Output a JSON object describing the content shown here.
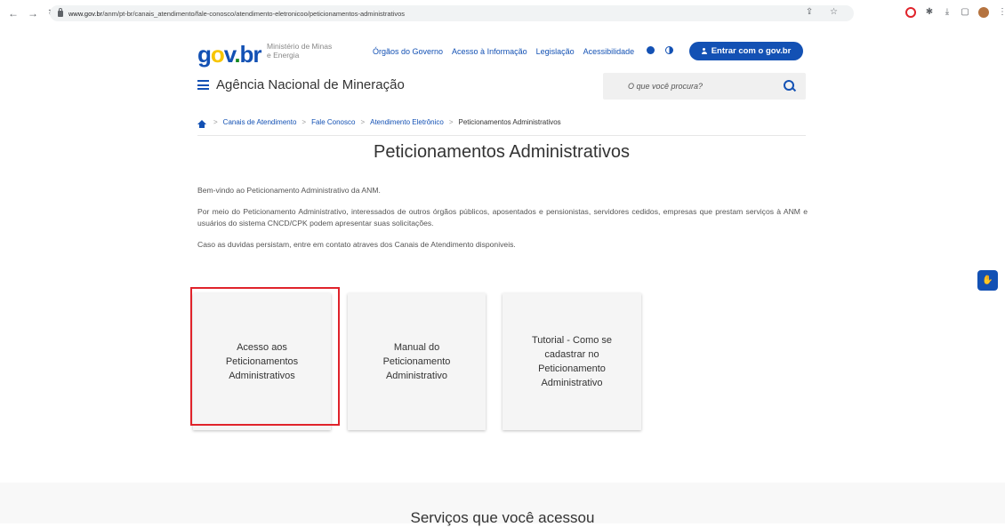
{
  "browser": {
    "url_host": "www.gov.br",
    "url_path": "/anm/pt-br/canais_atendimento/fale-conosco/atendimento-eletronicoo/peticionamentos-administrativos"
  },
  "header": {
    "logo": {
      "g": "g",
      "o": "o",
      "v": "v",
      "dot": ".",
      "br": "br"
    },
    "ministry": "Ministério de Minas e Energia",
    "links": [
      "Órgãos do Governo",
      "Acesso à Informação",
      "Legislação",
      "Acessibilidade"
    ],
    "login_label": "Entrar com o gov.br",
    "agency": "Agência Nacional de Mineração",
    "search_placeholder": "O que você procura?"
  },
  "breadcrumb": {
    "items": [
      "Canais de Atendimento",
      "Fale Conosco",
      "Atendimento Eletrônico"
    ],
    "current": "Peticionamentos Administrativos",
    "separator": ">"
  },
  "main": {
    "title": "Peticionamentos Administrativos",
    "paragraphs": [
      "Bem-vindo ao Peticionamento Administrativo da ANM.",
      "Por meio do Peticionamento Administrativo, interessados de outros órgãos públicos, aposentados e pensionistas, servidores cedidos, empresas que prestam serviços à ANM e usuários do sistema CNCD/CPK podem apresentar suas solicitações.",
      "Caso as duvidas persistam, entre em contato atraves dos Canais de Atendimento disponiveis."
    ],
    "cards": [
      "Acesso aos Peticionamentos Administrativos",
      "Manual do Peticionamento Administrativo",
      "Tutorial - Como se cadastrar no Peticionamento Administrativo"
    ]
  },
  "services": {
    "title": "Serviços que você acessou"
  },
  "colors": {
    "primary": "#1351b4",
    "highlight": "#e0232b",
    "logo_yellow": "#f7c500",
    "logo_green": "#168821"
  }
}
